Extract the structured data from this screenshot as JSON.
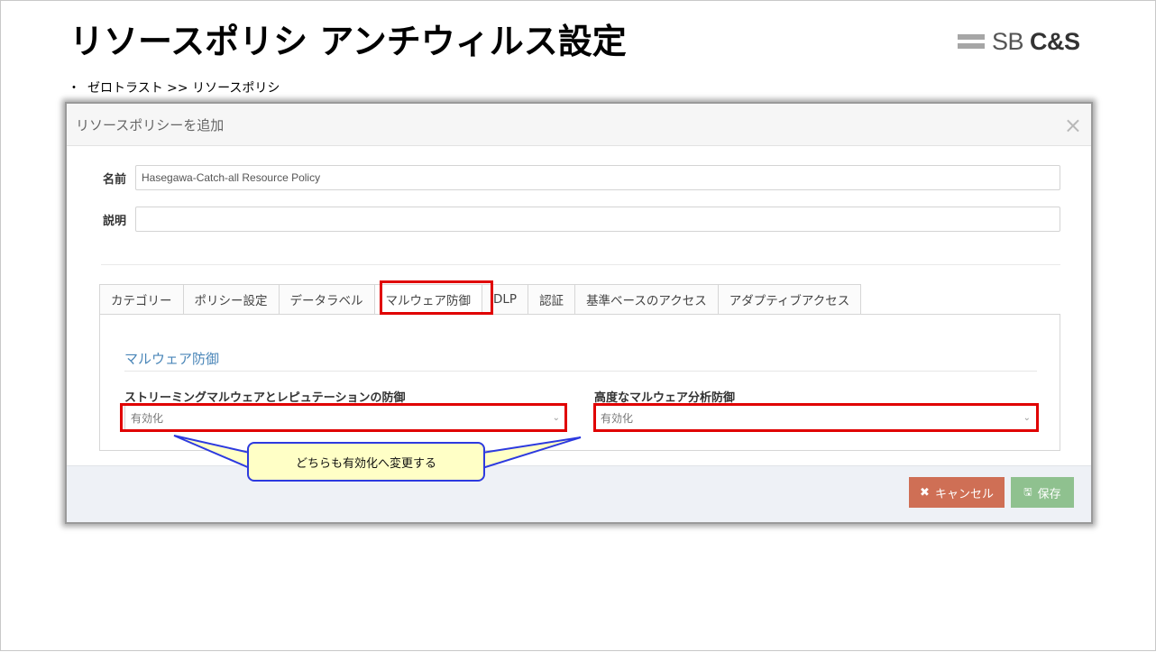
{
  "slide": {
    "title": "リソースポリシ アンチウィルス設定",
    "bullet": "ゼロトラスト >> リソースポリシ",
    "logo": {
      "left": "SB",
      "right": "C&S"
    }
  },
  "modal": {
    "title": "リソースポリシーを追加",
    "close": "×",
    "name_label": "名前",
    "name_value": "Hasegawa-Catch-all Resource Policy",
    "desc_label": "説明",
    "desc_value": "",
    "tabs": [
      {
        "label": "カテゴリー"
      },
      {
        "label": "ポリシー設定"
      },
      {
        "label": "データラベル"
      },
      {
        "label": "マルウェア防御"
      },
      {
        "label": "DLP"
      },
      {
        "label": "認証"
      },
      {
        "label": "基準ベースのアクセス"
      },
      {
        "label": "アダプティブアクセス"
      }
    ],
    "active_tab": "マルウェア防御",
    "section_title": "マルウェア防御",
    "streaming": {
      "label": "ストリーミングマルウェアとレピュテーションの防御",
      "value": "有効化"
    },
    "advanced": {
      "label": "高度なマルウェア分析防御",
      "value": "有効化"
    },
    "cancel_label": "キャンセル",
    "save_label": "保存"
  },
  "callout": {
    "text": "どちらも有効化へ変更する"
  },
  "colors": {
    "highlight": "#e00000",
    "callout_border": "#2d3adf",
    "callout_fill": "#ffffc6",
    "cancel": "#cf6f55",
    "save": "#8fc18f",
    "section_title": "#4a86b8"
  },
  "icons": [
    "close-icon",
    "chevron-down-icon",
    "x-icon",
    "save-icon"
  ]
}
